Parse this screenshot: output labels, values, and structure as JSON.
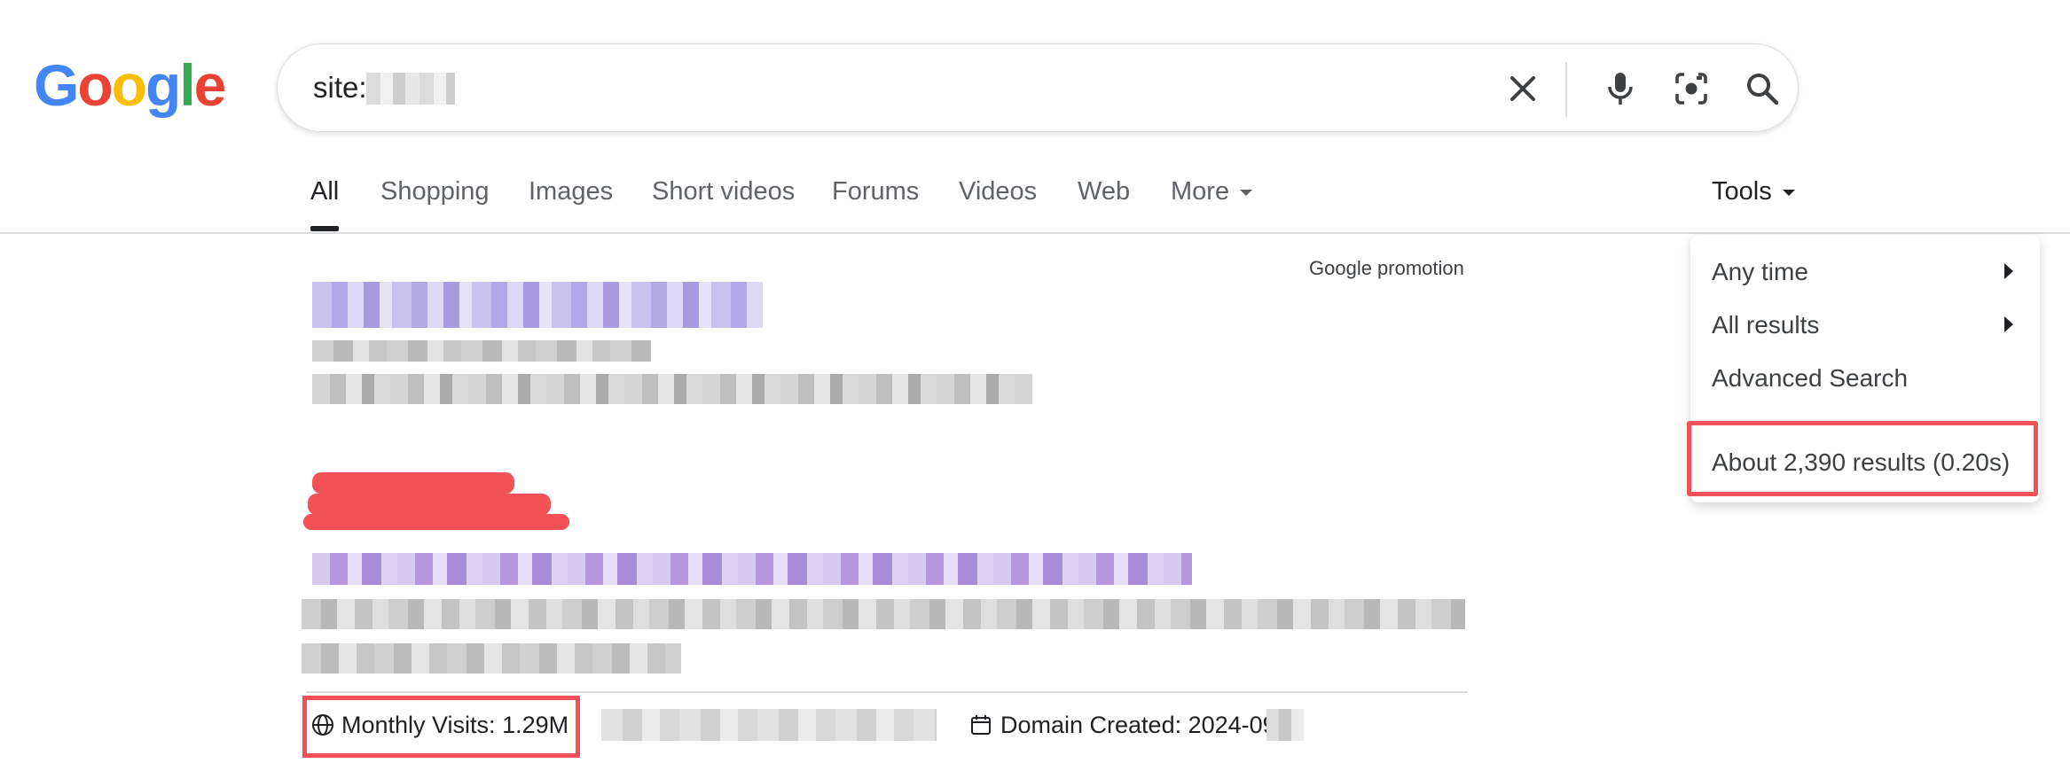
{
  "logo": {
    "letters": [
      "G",
      "o",
      "o",
      "g",
      "l",
      "e"
    ],
    "colors": [
      "#4285F4",
      "#EA4335",
      "#FBBC05",
      "#4285F4",
      "#34A853",
      "#EA4335"
    ]
  },
  "search": {
    "query": "site:"
  },
  "icons": {
    "clear": "close-icon",
    "voice": "mic-icon",
    "lens": "camera-icon",
    "search": "search-icon"
  },
  "tabs": [
    {
      "label": "All",
      "active": true
    },
    {
      "label": "Shopping"
    },
    {
      "label": "Images"
    },
    {
      "label": "Short videos"
    },
    {
      "label": "Forums"
    },
    {
      "label": "Videos"
    },
    {
      "label": "Web"
    },
    {
      "label": "More"
    }
  ],
  "tools_label": "Tools",
  "promo_label": "Google promotion",
  "tools_menu": {
    "items": [
      {
        "label": "Any time",
        "has_submenu": true
      },
      {
        "label": "All results",
        "has_submenu": true
      },
      {
        "label": "Advanced Search",
        "has_submenu": false
      }
    ],
    "result_stats": "About 2,390 results (0.20s)"
  },
  "footer": {
    "visits_label": "Monthly Visits: 1.29M",
    "domain_label": "Domain Created: 2024-09-"
  },
  "colors": {
    "highlight": "#ef5257",
    "redaction_red": "#f25156",
    "link_purple": "#a99ae0"
  }
}
